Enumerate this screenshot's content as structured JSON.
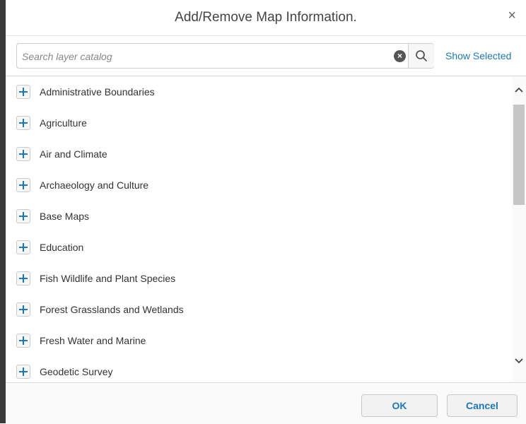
{
  "dialog": {
    "title": "Add/Remove Map Information.",
    "close_glyph": "×",
    "close_icon": "close-icon"
  },
  "search": {
    "value": "",
    "placeholder": "Search layer catalog",
    "clear_glyph": "×",
    "clear_icon": "clear-circle-icon",
    "search_icon": "magnifier-icon",
    "show_selected_label": "Show Selected"
  },
  "layers": [
    {
      "label": "Administrative Boundaries"
    },
    {
      "label": "Agriculture"
    },
    {
      "label": "Air and Climate"
    },
    {
      "label": "Archaeology and Culture"
    },
    {
      "label": "Base Maps"
    },
    {
      "label": "Education"
    },
    {
      "label": "Fish Wildlife and Plant Species"
    },
    {
      "label": "Forest Grasslands and Wetlands"
    },
    {
      "label": "Fresh Water and Marine"
    },
    {
      "label": "Geodetic Survey"
    }
  ],
  "scrollbar": {
    "up_glyph": "^",
    "down_glyph": "v"
  },
  "footer": {
    "ok_label": "OK",
    "cancel_label": "Cancel"
  },
  "colors": {
    "accent": "#1f78b4",
    "scroll_thumb": "#c6c6c6",
    "left_edge": "#3a3a3a"
  }
}
